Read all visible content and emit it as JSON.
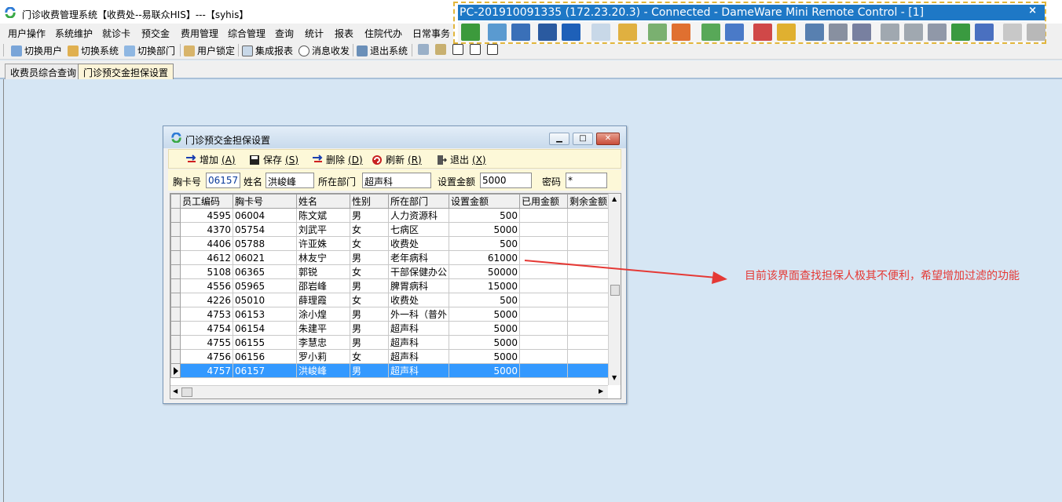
{
  "window": {
    "title": "门诊收费管理系统【收费处--易联众HIS】---【syhis】"
  },
  "menu": [
    "用户操作",
    "系统维护",
    "就诊卡",
    "预交金",
    "费用管理",
    "综合管理",
    "查询",
    "统计",
    "报表",
    "住院代办",
    "日常事务"
  ],
  "toolbar": {
    "items": [
      "切换用户",
      "切换系统",
      "切换部门",
      "用户锁定",
      "集成报表",
      "消息收发",
      "退出系统"
    ]
  },
  "tabs": [
    "收费员综合查询",
    "门诊预交金担保设置"
  ],
  "remote": {
    "title": "PC-201910091335 (172.23.20.3) - Connected - DameWare Mini Remote Control - [1]",
    "close": "×"
  },
  "dialog": {
    "title": "门诊预交金担保设置",
    "buttons": {
      "add": "增加",
      "add_key": "(A)",
      "save": "保存",
      "save_key": "(S)",
      "delete": "删除",
      "delete_key": "(D)",
      "refresh": "刷新",
      "refresh_key": "(R)",
      "exit": "退出",
      "exit_key": "(X)"
    },
    "form": {
      "card_label": "胸卡号",
      "card_value": "06157",
      "name_label": "姓名",
      "name_value": "洪峻峰",
      "dept_label": "所在部门",
      "dept_value": "超声科",
      "amount_label": "设置金额",
      "amount_value": "5000",
      "pwd_label": "密码",
      "pwd_value": "*"
    },
    "grid": {
      "headers": [
        "员工编码",
        "胸卡号",
        "姓名",
        "性别",
        "所在部门",
        "设置金额",
        "已用金额",
        "剩余金额"
      ],
      "rows": [
        [
          "4595",
          "06004",
          "陈文斌",
          "男",
          "人力资源科",
          "500",
          "",
          ""
        ],
        [
          "4370",
          "05754",
          "刘武平",
          "女",
          "七病区",
          "5000",
          "",
          ""
        ],
        [
          "4406",
          "05788",
          "许亚姝",
          "女",
          "收费处",
          "500",
          "",
          ""
        ],
        [
          "4612",
          "06021",
          "林友宁",
          "男",
          "老年病科",
          "61000",
          "",
          ""
        ],
        [
          "5108",
          "06365",
          "郭锐",
          "女",
          "干部保健办公",
          "50000",
          "",
          ""
        ],
        [
          "4556",
          "05965",
          "邵岩峰",
          "男",
          "脾胃病科",
          "15000",
          "",
          ""
        ],
        [
          "4226",
          "05010",
          "薛理霞",
          "女",
          "收费处",
          "500",
          "",
          ""
        ],
        [
          "4753",
          "06153",
          "涂小煌",
          "男",
          "外一科（普外",
          "5000",
          "",
          ""
        ],
        [
          "4754",
          "06154",
          "朱建平",
          "男",
          "超声科",
          "5000",
          "",
          ""
        ],
        [
          "4755",
          "06155",
          "李慧忠",
          "男",
          "超声科",
          "5000",
          "",
          ""
        ],
        [
          "4756",
          "06156",
          "罗小莉",
          "女",
          "超声科",
          "5000",
          "",
          ""
        ],
        [
          "4757",
          "06157",
          "洪峻峰",
          "男",
          "超声科",
          "5000",
          "",
          ""
        ]
      ],
      "selected_index": 11
    }
  },
  "annotation": {
    "text": "目前该界面查找担保人极其不便利，希望增加过滤的功能",
    "color": "#e53935"
  }
}
